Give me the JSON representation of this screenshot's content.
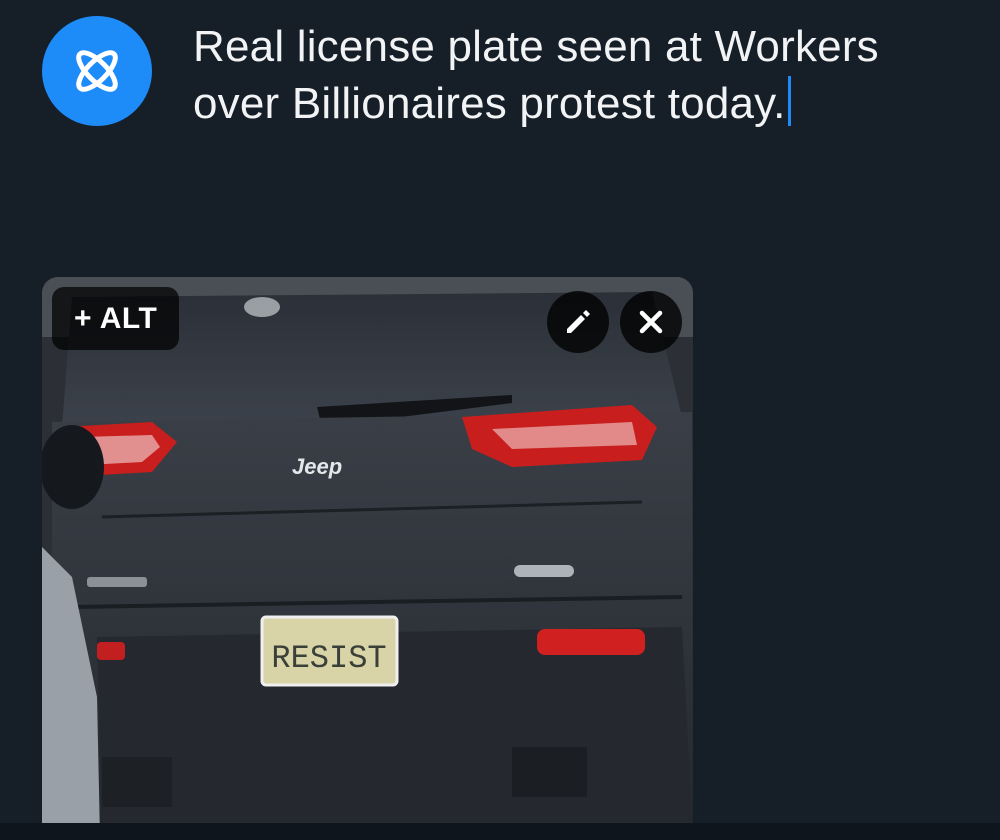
{
  "composer": {
    "post_text": "Real license plate seen at Workers over Billionaires protest today.",
    "avatar_icon": "atom-icon",
    "accent_color": "#1d8cf8"
  },
  "media": {
    "alt_button_label": "+ ALT",
    "edit_icon": "pencil-icon",
    "remove_icon": "close-icon",
    "photo": {
      "badge_text": "Jeep",
      "plate_text": "RESIST"
    }
  }
}
